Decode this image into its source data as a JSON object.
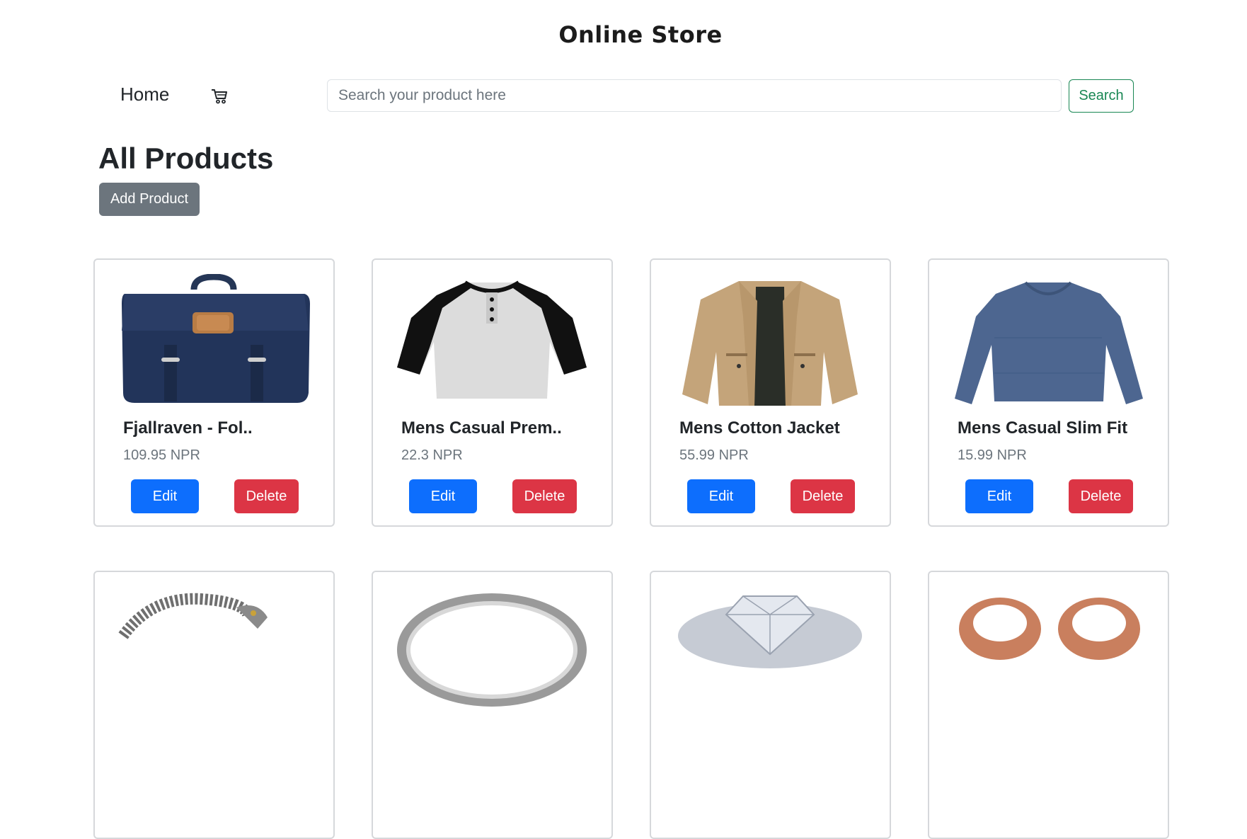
{
  "header": {
    "title": "Online Store"
  },
  "nav": {
    "home_label": "Home",
    "cart_icon": "cart-icon"
  },
  "search": {
    "placeholder": "Search your product here",
    "value": "",
    "button_label": "Search"
  },
  "page": {
    "heading": "All Products",
    "add_button_label": "Add Product"
  },
  "colors": {
    "primary": "#0d6efd",
    "danger": "#dc3545",
    "secondary": "#6c757d",
    "success": "#198754"
  },
  "products": [
    {
      "title": "Fjallraven - Fol..",
      "price": "109.95 NPR",
      "image": "backpack-image",
      "edit_label": "Edit",
      "delete_label": "Delete"
    },
    {
      "title": "Mens Casual Prem..",
      "price": "22.3 NPR",
      "image": "tshirt-image",
      "edit_label": "Edit",
      "delete_label": "Delete"
    },
    {
      "title": "Mens Cotton Jacket",
      "price": "55.99 NPR",
      "image": "jacket-image",
      "edit_label": "Edit",
      "delete_label": "Delete"
    },
    {
      "title": "Mens Casual Slim Fit",
      "price": "15.99 NPR",
      "image": "longsleeve-image",
      "edit_label": "Edit",
      "delete_label": "Delete"
    },
    {
      "title": "",
      "price": "",
      "image": "bracelet-image"
    },
    {
      "title": "",
      "price": "",
      "image": "ring-image"
    },
    {
      "title": "",
      "price": "",
      "image": "diamond-ring-image"
    },
    {
      "title": "",
      "price": "",
      "image": "earrings-image"
    }
  ]
}
